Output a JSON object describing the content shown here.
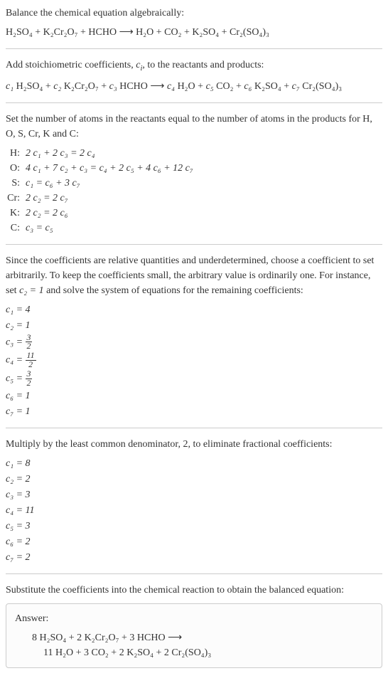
{
  "intro1": "Balance the chemical equation algebraically:",
  "eq1": "H₂SO₄ + K₂Cr₂O₇ + HCHO ⟶ H₂O + CO₂ + K₂SO₄ + Cr₂(SO₄)₃",
  "intro2_a": "Add stoichiometric coefficients, ",
  "intro2_c": "c",
  "intro2_i": "i",
  "intro2_b": ", to the reactants and products:",
  "eq2_c1": "c₁",
  "eq2_r1": " H₂SO₄ + ",
  "eq2_c2": "c₂",
  "eq2_r2": " K₂Cr₂O₇ + ",
  "eq2_c3": "c₃",
  "eq2_r3": " HCHO ⟶ ",
  "eq2_c4": "c₄",
  "eq2_r4": " H₂O + ",
  "eq2_c5": "c₅",
  "eq2_r5": " CO₂ + ",
  "eq2_c6": "c₆",
  "eq2_r6": " K₂SO₄ + ",
  "eq2_c7": "c₇",
  "eq2_r7": " Cr₂(SO₄)₃",
  "intro3": "Set the number of atoms in the reactants equal to the number of atoms in the products for H, O, S, Cr, K and C:",
  "atoms": {
    "H": {
      "label": "H:",
      "eq": "2 c₁ + 2 c₃ = 2 c₄"
    },
    "O": {
      "label": "O:",
      "eq": "4 c₁ + 7 c₂ + c₃ = c₄ + 2 c₅ + 4 c₆ + 12 c₇"
    },
    "S": {
      "label": "S:",
      "eq": "c₁ = c₆ + 3 c₇"
    },
    "Cr": {
      "label": "Cr:",
      "eq": "2 c₂ = 2 c₇"
    },
    "K": {
      "label": "K:",
      "eq": "2 c₂ = 2 c₆"
    },
    "C": {
      "label": "C:",
      "eq": "c₃ = c₅"
    }
  },
  "intro4_a": "Since the coefficients are relative quantities and underdetermined, choose a coefficient to set arbitrarily. To keep the coefficients small, the arbitrary value is ordinarily one. For instance, set ",
  "intro4_c2": "c₂ = 1",
  "intro4_b": " and solve the system of equations for the remaining coefficients:",
  "coeffs1": {
    "c1": "c₁ = 4",
    "c2": "c₂ = 1",
    "c3_pre": "c₃ = ",
    "c3_num": "3",
    "c3_den": "2",
    "c4_pre": "c₄ = ",
    "c4_num": "11",
    "c4_den": "2",
    "c5_pre": "c₅ = ",
    "c5_num": "3",
    "c5_den": "2",
    "c6": "c₆ = 1",
    "c7": "c₇ = 1"
  },
  "intro5": "Multiply by the least common denominator, 2, to eliminate fractional coefficients:",
  "coeffs2": {
    "c1": "c₁ = 8",
    "c2": "c₂ = 2",
    "c3": "c₃ = 3",
    "c4": "c₄ = 11",
    "c5": "c₅ = 3",
    "c6": "c₆ = 2",
    "c7": "c₇ = 2"
  },
  "intro6": "Substitute the coefficients into the chemical reaction to obtain the balanced equation:",
  "answer_label": "Answer:",
  "answer_line1": "8 H₂SO₄ + 2 K₂Cr₂O₇ + 3 HCHO ⟶",
  "answer_line2": "11 H₂O + 3 CO₂ + 2 K₂SO₄ + 2 Cr₂(SO₄)₃"
}
